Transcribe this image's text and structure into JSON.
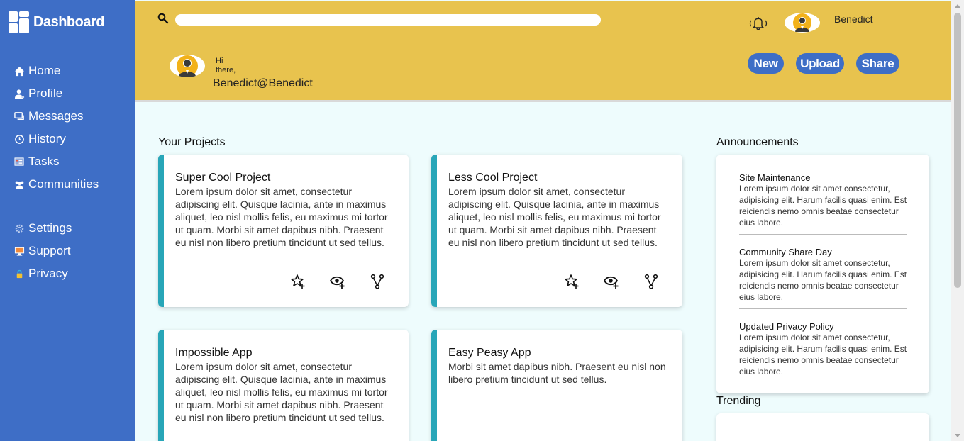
{
  "sidebar": {
    "brand": "Dashboard",
    "items": [
      {
        "label": "Home",
        "icon": "home-icon"
      },
      {
        "label": "Profile",
        "icon": "profile-icon"
      },
      {
        "label": "Messages",
        "icon": "messages-icon"
      },
      {
        "label": "History",
        "icon": "history-icon"
      },
      {
        "label": "Tasks",
        "icon": "tasks-icon"
      },
      {
        "label": "Communities",
        "icon": "communities-icon"
      }
    ],
    "secondary": [
      {
        "label": "Settings",
        "icon": "gear-icon"
      },
      {
        "label": "Support",
        "icon": "support-icon"
      },
      {
        "label": "Privacy",
        "icon": "lock-icon"
      }
    ]
  },
  "header": {
    "search_placeholder": "",
    "username": "Benedict",
    "greeting": "Hi there,",
    "handle": "Benedict@Benedict",
    "buttons": {
      "new": "New",
      "upload": "Upload",
      "share": "Share"
    }
  },
  "projects": {
    "title": "Your Projects",
    "items": [
      {
        "title": "Super Cool Project",
        "desc": "Lorem ipsum dolor sit amet, consectetur adipiscing elit. Quisque lacinia, ante in maximus aliquet, leo nisl mollis felis, eu maximus mi tortor ut quam. Morbi sit amet dapibus nibh. Praesent eu nisl non libero pretium tincidunt ut sed tellus."
      },
      {
        "title": "Less Cool Project",
        "desc": "Lorem ipsum dolor sit amet, consectetur adipiscing elit. Quisque lacinia, ante in maximus aliquet, leo nisl mollis felis, eu maximus mi tortor ut quam. Morbi sit amet dapibus nibh. Praesent eu nisl non libero pretium tincidunt ut sed tellus."
      },
      {
        "title": "Impossible App",
        "desc": "Lorem ipsum dolor sit amet, consectetur adipiscing elit. Quisque lacinia, ante in maximus aliquet, leo nisl mollis felis, eu maximus mi tortor ut quam. Morbi sit amet dapibus nibh. Praesent eu nisl non libero pretium tincidunt ut sed tellus."
      },
      {
        "title": "Easy Peasy App",
        "desc": "Morbi sit amet dapibus nibh. Praesent eu nisl non libero pretium tincidunt ut sed tellus."
      }
    ]
  },
  "announcements": {
    "title": "Announcements",
    "items": [
      {
        "title": "Site Maintenance",
        "body": "Lorem ipsum dolor sit amet consectetur, adipisicing elit. Harum facilis quasi enim. Est reiciendis nemo omnis beatae consectetur eius labore."
      },
      {
        "title": "Community Share Day",
        "body": "Lorem ipsum dolor sit amet consectetur, adipisicing elit. Harum facilis quasi enim. Est reiciendis nemo omnis beatae consectetur eius labore."
      },
      {
        "title": "Updated Privacy Policy",
        "body": "Lorem ipsum dolor sit amet consectetur, adipisicing elit. Harum facilis quasi enim. Est reiciendis nemo omnis beatae consectetur eius labore."
      }
    ]
  },
  "trending": {
    "title": "Trending"
  },
  "colors": {
    "sidebar": "#3e6ec6",
    "header": "#e8c34e",
    "accent": "#28a6b8",
    "background": "#eefcfd"
  }
}
